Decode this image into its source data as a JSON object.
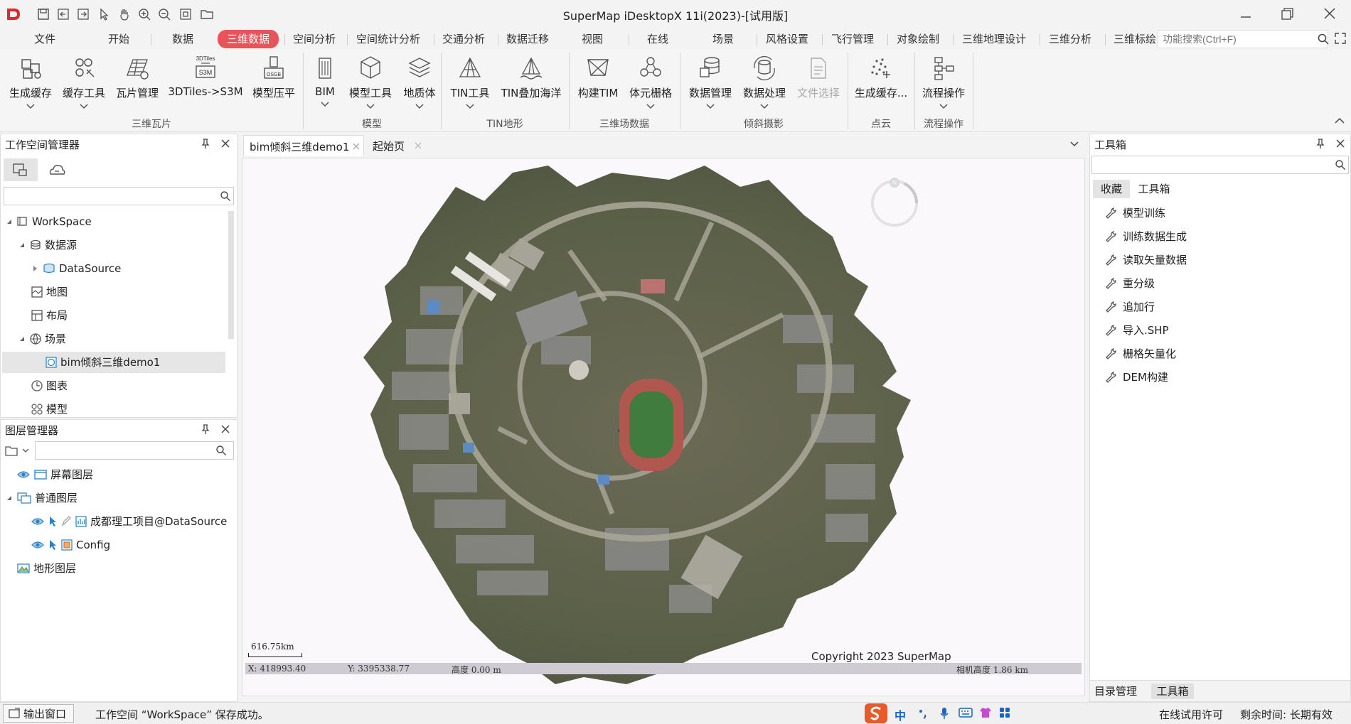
{
  "titlebar": {
    "title": "SuperMap iDesktopX 11i(2023)-[试用版]"
  },
  "tabs": [
    {
      "label": "文件"
    },
    {
      "label": "开始"
    },
    {
      "label": "数据"
    },
    {
      "label": "三维数据"
    },
    {
      "label": "空间分析"
    },
    {
      "label": "空间统计分析"
    },
    {
      "label": "交通分析"
    },
    {
      "label": "数据迁移"
    },
    {
      "label": "视图"
    },
    {
      "label": "在线"
    },
    {
      "label": "场景"
    },
    {
      "label": "风格设置"
    },
    {
      "label": "飞行管理"
    },
    {
      "label": "对象绘制"
    },
    {
      "label": "三维地理设计"
    },
    {
      "label": "三维分析"
    },
    {
      "label": "三维标绘"
    }
  ],
  "search": {
    "placeholder": "功能搜索(Ctrl+F)"
  },
  "ribbon": {
    "buttons": [
      {
        "label": "生成缓存"
      },
      {
        "label": "缓存工具"
      },
      {
        "label": "瓦片管理"
      },
      {
        "label": "3DTiles->S3M"
      },
      {
        "label": "模型压平"
      },
      {
        "label": "BIM"
      },
      {
        "label": "模型工具"
      },
      {
        "label": "地质体"
      },
      {
        "label": "TIN工具"
      },
      {
        "label": "TIN叠加海洋"
      },
      {
        "label": "构建TIM"
      },
      {
        "label": "体元栅格"
      },
      {
        "label": "数据管理"
      },
      {
        "label": "数据处理"
      },
      {
        "label": "文件选择"
      },
      {
        "label": "生成缓存..."
      },
      {
        "label": "流程操作"
      }
    ],
    "groups": [
      {
        "label": "三维瓦片"
      },
      {
        "label": "模型"
      },
      {
        "label": "TIN地形"
      },
      {
        "label": "三维场数据"
      },
      {
        "label": "倾斜摄影"
      },
      {
        "label": "点云"
      },
      {
        "label": "流程操作"
      }
    ],
    "icon_text_3dtiles": "3DTiles",
    "icon_text_s3m": "S3M",
    "icon_text_osgb": "OSGB"
  },
  "workspace_panel": {
    "title": "工作空间管理器",
    "tree": [
      {
        "label": "WorkSpace"
      },
      {
        "label": "数据源"
      },
      {
        "label": "DataSource"
      },
      {
        "label": "地图"
      },
      {
        "label": "布局"
      },
      {
        "label": "场景"
      },
      {
        "label": "bim倾斜三维demo1"
      },
      {
        "label": "图表"
      },
      {
        "label": "模型"
      }
    ]
  },
  "layer_panel": {
    "title": "图层管理器",
    "tree": [
      {
        "label": "屏幕图层"
      },
      {
        "label": "普通图层"
      },
      {
        "label": "成都理工项目@DataSource"
      },
      {
        "label": "Config"
      },
      {
        "label": "地形图层"
      }
    ]
  },
  "doc_tabs": [
    {
      "label": "bim倾斜三维demo1"
    },
    {
      "label": "起始页"
    }
  ],
  "viewport": {
    "compass_label": "N",
    "scale_text": "616.75km",
    "copyright": "Copyright 2023 SuperMap",
    "coord_x": "X: 418993.40",
    "coord_y": "Y: 3395338.77",
    "height": "高度 0.00 m",
    "view_height": "相机高度 1.86 km"
  },
  "toolbox_panel": {
    "title": "工具箱",
    "subtabs": [
      {
        "label": "收藏"
      },
      {
        "label": "工具箱"
      }
    ],
    "items": [
      {
        "label": "模型训练"
      },
      {
        "label": "训练数据生成"
      },
      {
        "label": "读取矢量数据"
      },
      {
        "label": "重分级"
      },
      {
        "label": "追加行"
      },
      {
        "label": "导入.SHP"
      },
      {
        "label": "栅格矢量化"
      },
      {
        "label": "DEM构建"
      }
    ],
    "bottom_tabs": [
      {
        "label": "目录管理"
      },
      {
        "label": "工具箱"
      }
    ]
  },
  "statusbar": {
    "output_button": "输出窗口",
    "message": "工作空间 “WorkSpace” 保存成功。",
    "ime_label": "中",
    "license": "在线试用许可",
    "remaining": "剩余时间: 长期有效"
  },
  "colors": {
    "accent": "#e8545a",
    "icon": "#555555",
    "ground": "#5d6048"
  }
}
